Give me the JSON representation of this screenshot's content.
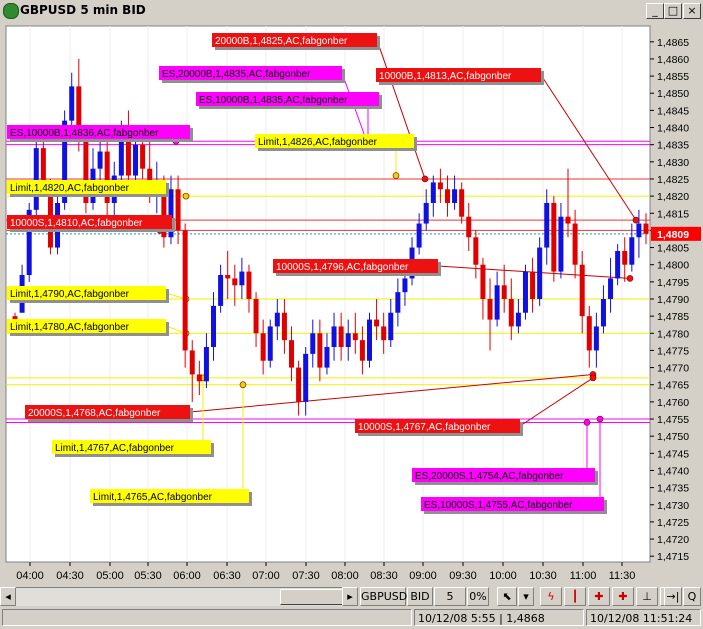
{
  "window": {
    "title": "GBPUSD 5 min BID",
    "minimize_glyph": "_",
    "maximize_glyph": "□",
    "close_glyph": "×"
  },
  "colors": {
    "chart_bg": "#ffffff",
    "up": "#1010e0",
    "down": "#e00000",
    "yellow": "#ffff00",
    "magenta": "#ff00ff",
    "red_label": "#ee1111",
    "current_price_bg": "#ff0000"
  },
  "toolbar": {
    "symbol": "GBPUSD",
    "side": "BID",
    "interval": "5 min",
    "percent": "0%",
    "icons": [
      "cursor-icon",
      "dropdown-arrow-icon",
      "drawing-tool-icon",
      "candle-down-icon",
      "order-tool-icon",
      "order-tool-2-icon",
      "range-icon",
      "chart-tool-icon",
      "goto-end-icon",
      "zoom-icon"
    ]
  },
  "status": {
    "left_cell": "",
    "point": "10/12/08 5:55 | 1,4868",
    "time": "10/12/08 11:51:24"
  },
  "chart_data": {
    "type": "candlestick",
    "title": "GBPUSD 5 min BID",
    "ylim": [
      1.4711,
      1.4873
    ],
    "yticks": [
      "1,4865",
      "1,4860",
      "1,4855",
      "1,4850",
      "1,4845",
      "1,4840",
      "1,4835",
      "1,4830",
      "1,4825",
      "1,4820",
      "1,4815",
      "1,4810",
      "1,4805",
      "1,4800",
      "1,4795",
      "1,4790",
      "1,4785",
      "1,4780",
      "1,4775",
      "1,4770",
      "1,4765",
      "1,4760",
      "1,4755",
      "1,4750",
      "1,4745",
      "1,4740",
      "1,4735",
      "1,4730",
      "1,4725",
      "1,4720",
      "1,4715"
    ],
    "xticks": [
      "04:00",
      "04:30",
      "05:00",
      "05:30",
      "06:00",
      "06:30",
      "07:00",
      "07:30",
      "08:00",
      "08:30",
      "09:00",
      "09:30",
      "10:00",
      "10:30",
      "11:00",
      "11:30"
    ],
    "current_price": "1,4809",
    "candles": [
      [
        1.4785,
        1.4786,
        1.4782,
        1.478
      ],
      [
        1.4786,
        1.48,
        1.4797,
        1.4786
      ],
      [
        1.4797,
        1.4818,
        1.4816,
        1.4795
      ],
      [
        1.4816,
        1.4836,
        1.4834,
        1.4813
      ],
      [
        1.4834,
        1.4838,
        1.4822,
        1.482
      ],
      [
        1.4822,
        1.4825,
        1.4805,
        1.4803
      ],
      [
        1.4805,
        1.4822,
        1.4818,
        1.4803
      ],
      [
        1.4818,
        1.4845,
        1.4842,
        1.4816
      ],
      [
        1.4842,
        1.4856,
        1.4852,
        1.4838
      ],
      [
        1.4852,
        1.486,
        1.4836,
        1.4833
      ],
      [
        1.4836,
        1.4838,
        1.4818,
        1.4815
      ],
      [
        1.4818,
        1.4834,
        1.4828,
        1.4816
      ],
      [
        1.4828,
        1.4838,
        1.4833,
        1.4824
      ],
      [
        1.4833,
        1.4836,
        1.4818,
        1.4814
      ],
      [
        1.4818,
        1.483,
        1.4826,
        1.4812
      ],
      [
        1.4826,
        1.4842,
        1.4838,
        1.4824
      ],
      [
        1.4838,
        1.4845,
        1.4826,
        1.4822
      ],
      [
        1.4826,
        1.484,
        1.4835,
        1.4822
      ],
      [
        1.4835,
        1.484,
        1.4828,
        1.4825
      ],
      [
        1.4828,
        1.4838,
        1.4822,
        1.4818
      ],
      [
        1.4822,
        1.483,
        1.4824,
        1.4815
      ],
      [
        1.4824,
        1.4826,
        1.4808,
        1.4805
      ],
      [
        1.4808,
        1.4826,
        1.4822,
        1.4806
      ],
      [
        1.4822,
        1.4826,
        1.481,
        1.4806
      ],
      [
        1.481,
        1.4812,
        1.4775,
        1.477
      ],
      [
        1.4775,
        1.4778,
        1.4768,
        1.476
      ],
      [
        1.4768,
        1.4772,
        1.4766,
        1.4762
      ],
      [
        1.4766,
        1.478,
        1.4776,
        1.4764
      ],
      [
        1.4776,
        1.4792,
        1.4788,
        1.4772
      ],
      [
        1.4788,
        1.48,
        1.4797,
        1.4786
      ],
      [
        1.4797,
        1.4804,
        1.4796,
        1.479
      ],
      [
        1.4796,
        1.48,
        1.4794,
        1.4788
      ],
      [
        1.4794,
        1.4802,
        1.4798,
        1.479
      ],
      [
        1.4798,
        1.48,
        1.479,
        1.4786
      ],
      [
        1.479,
        1.4792,
        1.478,
        1.4776
      ],
      [
        1.478,
        1.4784,
        1.4772,
        1.4768
      ],
      [
        1.4772,
        1.4784,
        1.4782,
        1.477
      ],
      [
        1.4782,
        1.479,
        1.4786,
        1.4778
      ],
      [
        1.4786,
        1.479,
        1.4778,
        1.4774
      ],
      [
        1.4778,
        1.4782,
        1.477,
        1.4766
      ],
      [
        1.477,
        1.4772,
        1.476,
        1.4756
      ],
      [
        1.476,
        1.4776,
        1.4774,
        1.4756
      ],
      [
        1.4774,
        1.4784,
        1.478,
        1.477
      ],
      [
        1.478,
        1.4784,
        1.477,
        1.4766
      ],
      [
        1.477,
        1.478,
        1.4776,
        1.4768
      ],
      [
        1.4776,
        1.4786,
        1.4782,
        1.4772
      ],
      [
        1.4782,
        1.4786,
        1.4776,
        1.4772
      ],
      [
        1.4776,
        1.4784,
        1.478,
        1.4772
      ],
      [
        1.478,
        1.4786,
        1.4778,
        1.4774
      ],
      [
        1.4778,
        1.4782,
        1.4772,
        1.4768
      ],
      [
        1.4772,
        1.4786,
        1.4784,
        1.477
      ],
      [
        1.4784,
        1.479,
        1.4782,
        1.4778
      ],
      [
        1.4782,
        1.4786,
        1.4778,
        1.4774
      ],
      [
        1.4778,
        1.479,
        1.4786,
        1.4776
      ],
      [
        1.4786,
        1.4796,
        1.4792,
        1.4782
      ],
      [
        1.4792,
        1.48,
        1.4796,
        1.4788
      ],
      [
        1.4796,
        1.4808,
        1.4805,
        1.4794
      ],
      [
        1.4805,
        1.4815,
        1.4812,
        1.4803
      ],
      [
        1.4812,
        1.4822,
        1.4818,
        1.481
      ],
      [
        1.4818,
        1.4826,
        1.4824,
        1.4814
      ],
      [
        1.4824,
        1.4828,
        1.4822,
        1.4818
      ],
      [
        1.4822,
        1.4826,
        1.4818,
        1.4814
      ],
      [
        1.4818,
        1.4826,
        1.4822,
        1.4816
      ],
      [
        1.4822,
        1.4824,
        1.4814,
        1.4812
      ],
      [
        1.4814,
        1.4818,
        1.4808,
        1.4804
      ],
      [
        1.4808,
        1.481,
        1.48,
        1.4796
      ],
      [
        1.48,
        1.4802,
        1.479,
        1.4784
      ],
      [
        1.479,
        1.4796,
        1.4784,
        1.4775
      ],
      [
        1.4784,
        1.4798,
        1.4794,
        1.4782
      ],
      [
        1.4794,
        1.48,
        1.479,
        1.4786
      ],
      [
        1.479,
        1.4796,
        1.4782,
        1.4778
      ],
      [
        1.4782,
        1.479,
        1.4786,
        1.478
      ],
      [
        1.4786,
        1.48,
        1.4798,
        1.4784
      ],
      [
        1.4798,
        1.4802,
        1.479,
        1.4786
      ],
      [
        1.479,
        1.4808,
        1.4805,
        1.4788
      ],
      [
        1.4805,
        1.4822,
        1.4818,
        1.48
      ],
      [
        1.4818,
        1.482,
        1.4798,
        1.4795
      ],
      [
        1.4798,
        1.4818,
        1.4814,
        1.4796
      ],
      [
        1.4814,
        1.4828,
        1.4812,
        1.4808
      ],
      [
        1.4812,
        1.4816,
        1.48,
        1.4796
      ],
      [
        1.48,
        1.4804,
        1.4785,
        1.478
      ],
      [
        1.4785,
        1.4788,
        1.4775,
        1.477
      ],
      [
        1.4775,
        1.4786,
        1.4782,
        1.477
      ],
      [
        1.4782,
        1.4794,
        1.479,
        1.478
      ],
      [
        1.479,
        1.4802,
        1.4796,
        1.4786
      ],
      [
        1.4796,
        1.4806,
        1.4804,
        1.4794
      ],
      [
        1.4804,
        1.4808,
        1.48,
        1.4795
      ],
      [
        1.48,
        1.4812,
        1.4808,
        1.4798
      ],
      [
        1.4808,
        1.4816,
        1.4812,
        1.4802
      ],
      [
        1.4812,
        1.4815,
        1.4809,
        1.4806
      ]
    ],
    "hlines": [
      {
        "price": 1.4836,
        "color": "#ff00ff"
      },
      {
        "price": 1.4835,
        "color": "#ff00ff"
      },
      {
        "price": 1.4825,
        "color": "#ee3333"
      },
      {
        "price": 1.482,
        "color": "#f0f000"
      },
      {
        "price": 1.4813,
        "color": "#ee3333"
      },
      {
        "price": 1.481,
        "color": "#ee3333"
      },
      {
        "price": 1.479,
        "color": "#f0f000"
      },
      {
        "price": 1.478,
        "color": "#f0f000"
      },
      {
        "price": 1.4767,
        "color": "#f0f000"
      },
      {
        "price": 1.4765,
        "color": "#f0f000"
      },
      {
        "price": 1.4755,
        "color": "#ff00ff"
      },
      {
        "price": 1.4754,
        "color": "#ff00ff"
      }
    ],
    "annotations": [
      {
        "text": "20000B,1,4825,AC,fabgonber",
        "bg": "#ee1111",
        "fg": "#ffffff",
        "price": 1.4825
      },
      {
        "text": "10000B,1,4813,AC,fabgonber",
        "bg": "#ee1111",
        "fg": "#ffffff",
        "price": 1.4813
      },
      {
        "text": "ES,20000B,1,4835,AC,fabgonber",
        "bg": "#ff00ff",
        "fg": "#000000",
        "price": 1.4835
      },
      {
        "text": "ES,10000B,1,4835,AC,fabgonber",
        "bg": "#ff00ff",
        "fg": "#000000",
        "price": 1.4835
      },
      {
        "text": "ES,10000B,1,4836,AC,fabgonber",
        "bg": "#ff00ff",
        "fg": "#000000",
        "price": 1.4836
      },
      {
        "text": "Limit,1,4826,AC,fabgonber",
        "bg": "#ffff00",
        "fg": "#000000",
        "price": 1.4826
      },
      {
        "text": "Limit,1,4820,AC,fabgonber",
        "bg": "#ffff00",
        "fg": "#000000",
        "price": 1.482
      },
      {
        "text": "10000S,1,4810,AC,fabgonber",
        "bg": "#ee1111",
        "fg": "#ffffff",
        "price": 1.481
      },
      {
        "text": "10000S,1,4796,AC,fabgonber",
        "bg": "#ee1111",
        "fg": "#ffffff",
        "price": 1.4796
      },
      {
        "text": "Limit,1,4790,AC,fabgonber",
        "bg": "#ffff00",
        "fg": "#000000",
        "price": 1.479
      },
      {
        "text": "Limit,1,4780,AC,fabgonber",
        "bg": "#ffff00",
        "fg": "#000000",
        "price": 1.478
      },
      {
        "text": "20000S,1,4768,AC,fabgonber",
        "bg": "#ee1111",
        "fg": "#ffffff",
        "price": 1.4768
      },
      {
        "text": "10000S,1,4767,AC,fabgonber",
        "bg": "#ee1111",
        "fg": "#ffffff",
        "price": 1.4767
      },
      {
        "text": "Limit,1,4767,AC,fabgonber",
        "bg": "#ffff00",
        "fg": "#000000",
        "price": 1.4767
      },
      {
        "text": "ES,20000S,1,4754,AC,fabgonber",
        "bg": "#ff00ff",
        "fg": "#000000",
        "price": 1.4754
      },
      {
        "text": "Limit,1,4765,AC,fabgonber",
        "bg": "#ffff00",
        "fg": "#000000",
        "price": 1.4765
      },
      {
        "text": "ES,10000S,1,4755,AC,fabgonber",
        "bg": "#ff00ff",
        "fg": "#000000",
        "price": 1.4755
      }
    ]
  }
}
